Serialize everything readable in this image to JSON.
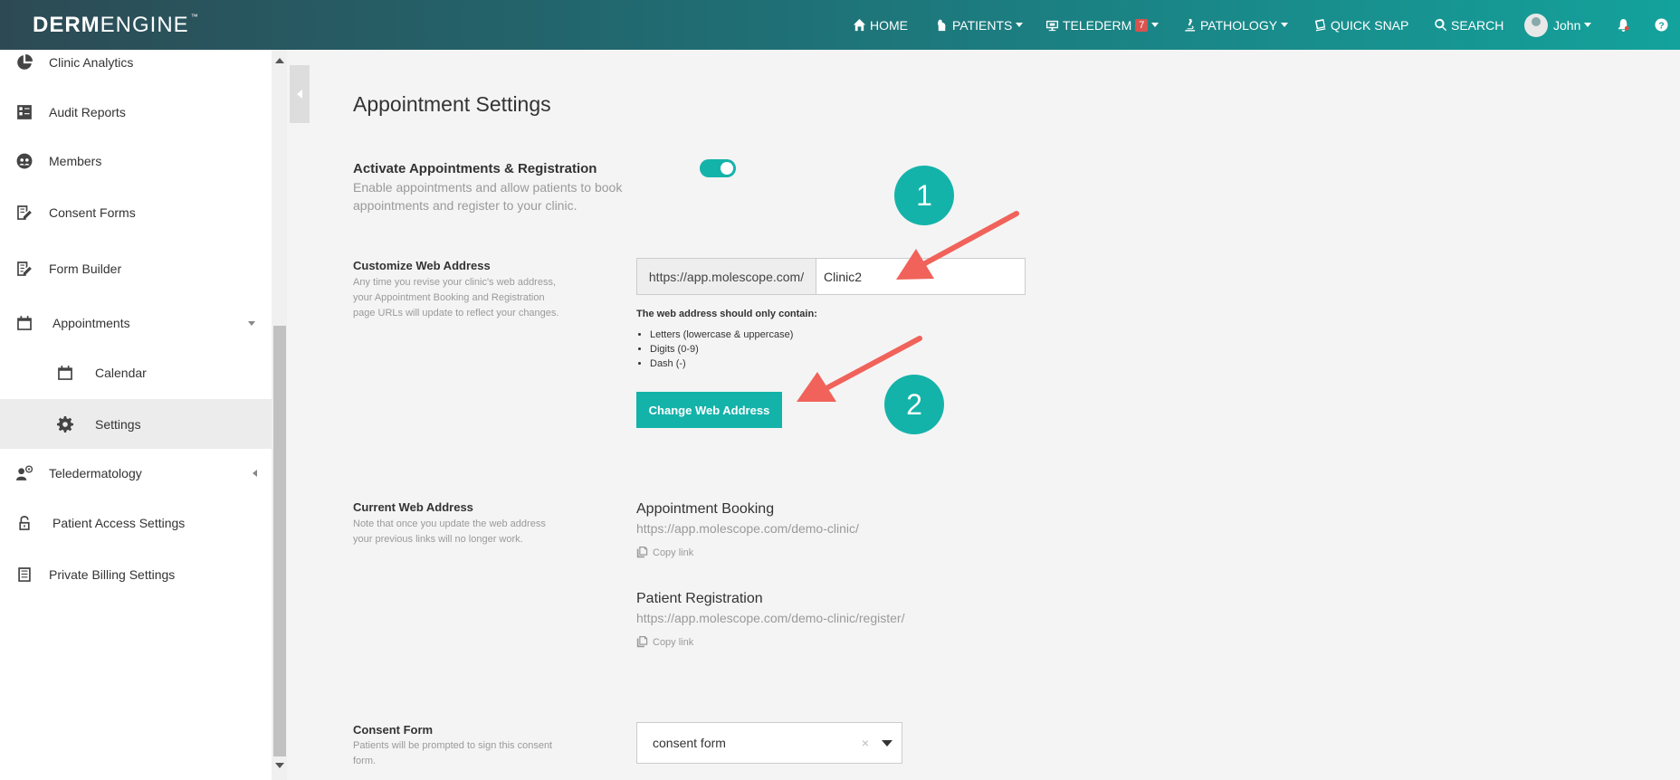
{
  "brand": {
    "logo_bold": "DERM",
    "logo_thin": "ENGINE",
    "trademark": "™"
  },
  "nav": {
    "home": "HOME",
    "patients": "PATIENTS",
    "telederm": "TELEDERM",
    "telederm_badge": "7",
    "pathology": "PATHOLOGY",
    "quick_snap": "QUICK SNAP",
    "search": "SEARCH",
    "user": "John"
  },
  "sidebar": {
    "items": [
      {
        "label": "Clinic Analytics",
        "icon": "pie-chart-icon"
      },
      {
        "label": "Audit Reports",
        "icon": "report-icon"
      },
      {
        "label": "Members",
        "icon": "members-icon"
      },
      {
        "label": "Consent Forms",
        "icon": "edit-form-icon"
      },
      {
        "label": "Form Builder",
        "icon": "form-builder-icon"
      },
      {
        "label": "Appointments",
        "icon": "calendar-icon"
      },
      {
        "label": "Calendar",
        "icon": "calendar-icon"
      },
      {
        "label": "Settings",
        "icon": "gear-icon"
      },
      {
        "label": "Teledermatology",
        "icon": "teledermatology-icon"
      },
      {
        "label": "Patient Access Settings",
        "icon": "lock-icon"
      },
      {
        "label": "Private Billing Settings",
        "icon": "billing-icon"
      }
    ]
  },
  "main": {
    "title": "Appointment Settings",
    "activate": {
      "label": "Activate Appointments & Registration",
      "desc1": "Enable appointments and allow patients to book",
      "desc2": "appointments and register to your clinic.",
      "enabled": true
    },
    "customize": {
      "label": "Customize Web Address",
      "desc1": "Any time you revise your clinic's web address,",
      "desc2": "your Appointment Booking and Registration",
      "desc3": "page URLs will update to reflect your changes.",
      "prefix": "https://app.molescope.com/",
      "value": "Clinic2",
      "rules_title": "The web address should only contain:",
      "rules": [
        "Letters (lowercase & uppercase)",
        "Digits (0-9)",
        "Dash (-)"
      ],
      "button": "Change Web Address"
    },
    "current": {
      "label": "Current Web Address",
      "desc1": "Note that once you update the web address",
      "desc2": "your previous links will no longer work.",
      "booking_title": "Appointment Booking",
      "booking_url": "https://app.molescope.com/demo-clinic/",
      "registration_title": "Patient Registration",
      "registration_url": "https://app.molescope.com/demo-clinic/register/",
      "copy_label": "Copy link"
    },
    "consent": {
      "label": "Consent Form",
      "desc1": "Patients will be prompted to sign this consent",
      "desc2": "form.",
      "value": "consent form",
      "clear": "×"
    }
  },
  "annotations": {
    "step1": "1",
    "step2": "2"
  },
  "colors": {
    "accent": "#14b3aa",
    "arrow": "#f0625a",
    "badge": "#d9534f"
  }
}
